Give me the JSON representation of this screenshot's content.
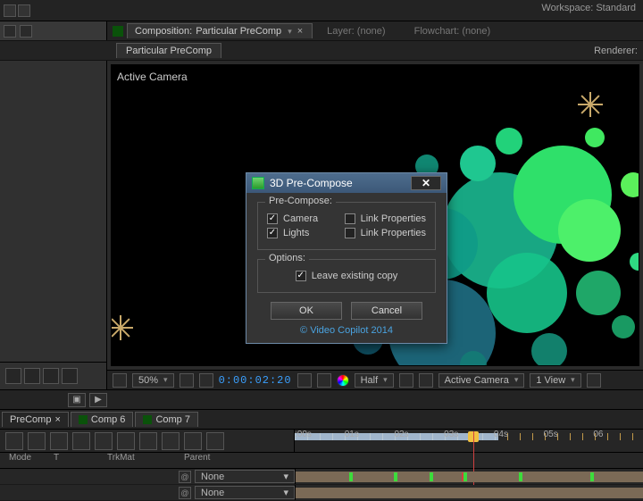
{
  "workspace_label": "Workspace:",
  "workspace_value": "Standard",
  "header": {
    "comp_prefix": "Composition:",
    "comp_name": "Particular PreComp",
    "layer_tab": "Layer: (none)",
    "flowchart_tab": "Flowchart: (none)",
    "sub_tab": "Particular PreComp",
    "renderer": "Renderer:"
  },
  "viewer": {
    "active_camera": "Active Camera",
    "zoom": "50%",
    "timecode": "0:00:02:20",
    "format": "Half",
    "camera_sel": "Active Camera",
    "views": "1 View"
  },
  "dialog": {
    "title": "3D Pre-Compose",
    "group1": "Pre-Compose:",
    "camera": "Camera",
    "lights": "Lights",
    "link1": "Link Properties",
    "link2": "Link Properties",
    "group2": "Options:",
    "leave": "Leave existing copy",
    "ok": "OK",
    "cancel": "Cancel",
    "copyright": "© Video Copilot 2014"
  },
  "timeline": {
    "tabs": [
      "PreComp",
      "Comp 6",
      "Comp 7"
    ],
    "ticks": [
      ":00s",
      "01s",
      "02s",
      "03s",
      "04s",
      "05s",
      "06"
    ],
    "headers": {
      "mode": "Mode",
      "t": "T",
      "trkmat": "TrkMat",
      "parent": "Parent"
    },
    "none": "None"
  }
}
